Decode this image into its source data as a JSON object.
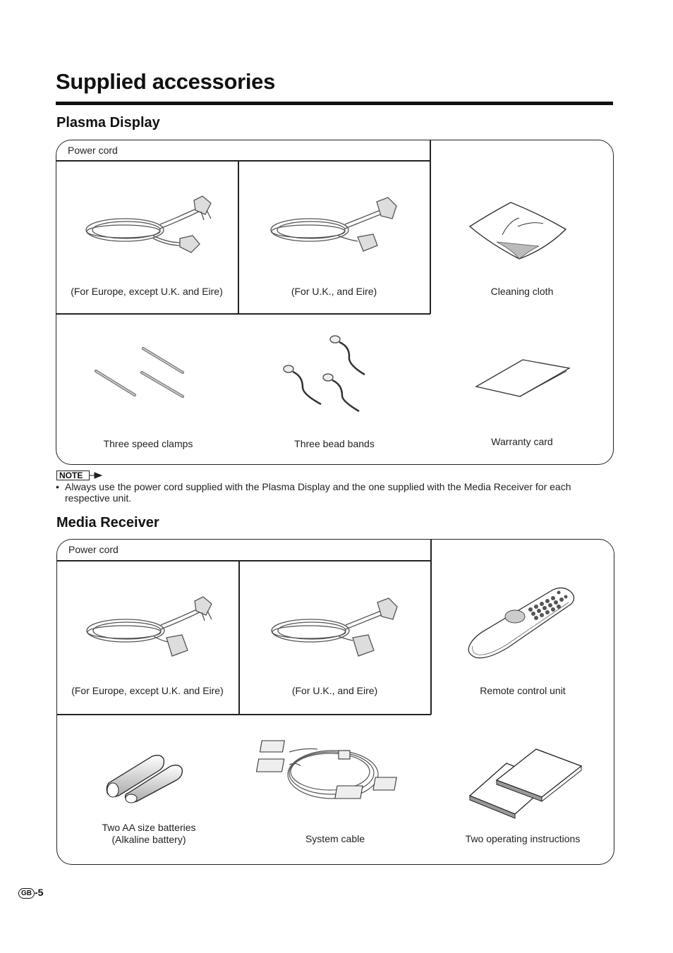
{
  "page": {
    "title": "Supplied accessories",
    "page_number": "-5",
    "region_badge": "GB"
  },
  "sections": [
    {
      "heading": "Plasma Display",
      "power_cord_label": "Power cord",
      "items": [
        {
          "icon": "power-cord-europe-icon",
          "label": "(For Europe, except U.K. and Eire)"
        },
        {
          "icon": "power-cord-uk-icon",
          "label": "(For U.K., and Eire)"
        },
        {
          "icon": "cleaning-cloth-icon",
          "label": "Cleaning cloth"
        },
        {
          "icon": "speed-clamps-icon",
          "label": "Three speed clamps"
        },
        {
          "icon": "bead-bands-icon",
          "label": "Three bead bands"
        },
        {
          "icon": "warranty-card-icon",
          "label": "Warranty card"
        }
      ]
    },
    {
      "heading": "Media Receiver",
      "power_cord_label": "Power cord",
      "items": [
        {
          "icon": "power-cord-europe-icon",
          "label": "(For Europe, except U.K. and Eire)"
        },
        {
          "icon": "power-cord-uk-icon",
          "label": "(For U.K., and Eire)"
        },
        {
          "icon": "remote-control-icon",
          "label": "Remote control unit"
        },
        {
          "icon": "batteries-icon",
          "label_line1": "Two AA size batteries",
          "label_line2": "(Alkaline battery)"
        },
        {
          "icon": "system-cable-icon",
          "label": "System cable"
        },
        {
          "icon": "operating-instructions-icon",
          "label": "Two operating instructions"
        }
      ]
    }
  ],
  "note": {
    "tag": "NOTE",
    "bullet": "•",
    "text": "Always use the power cord supplied with the Plasma Display and the one supplied with the Media Receiver for each respective unit."
  }
}
